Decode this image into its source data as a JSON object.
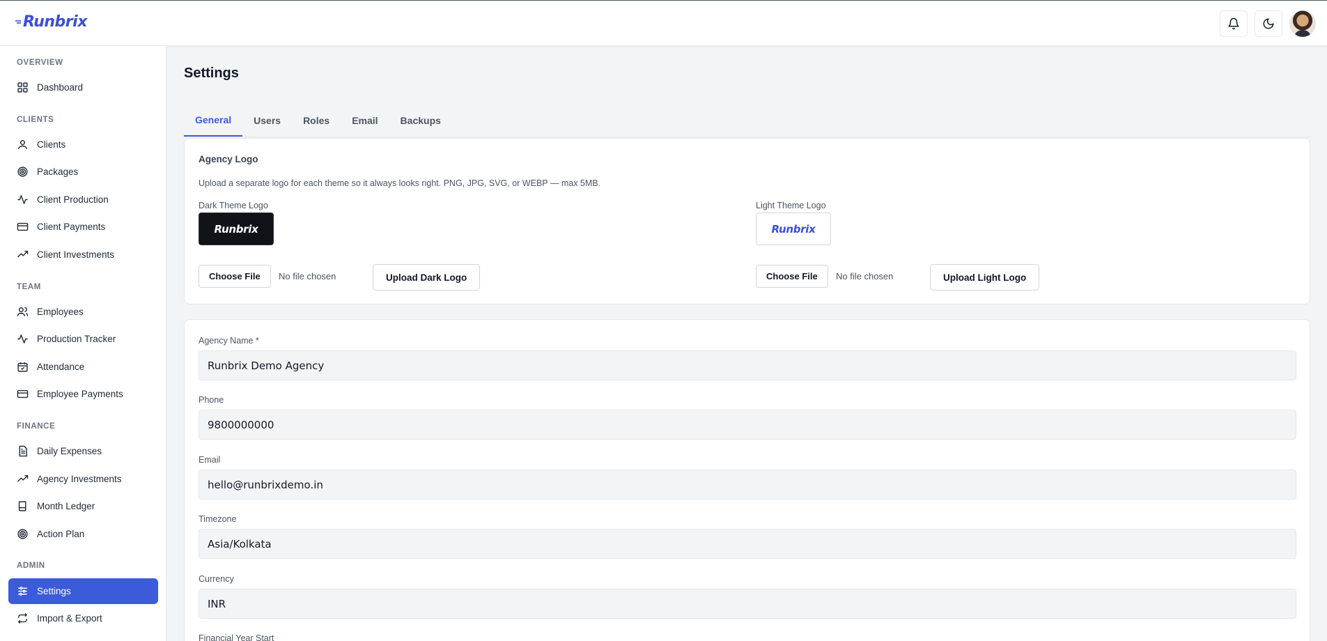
{
  "header": {
    "brand": "Runbrix",
    "icons": [
      "bell-icon",
      "moon-icon",
      "avatar"
    ]
  },
  "sidebar": {
    "sections": [
      {
        "label": "OVERVIEW",
        "items": [
          {
            "label": "Dashboard",
            "icon": "grid-icon"
          }
        ]
      },
      {
        "label": "CLIENTS",
        "items": [
          {
            "label": "Clients",
            "icon": "user-icon"
          },
          {
            "label": "Packages",
            "icon": "target-icon"
          },
          {
            "label": "Client Production",
            "icon": "activity-icon"
          },
          {
            "label": "Client Payments",
            "icon": "credit-card-icon"
          },
          {
            "label": "Client Investments",
            "icon": "trending-up-icon"
          }
        ]
      },
      {
        "label": "TEAM",
        "items": [
          {
            "label": "Employees",
            "icon": "users-icon"
          },
          {
            "label": "Production Tracker",
            "icon": "activity-icon"
          },
          {
            "label": "Attendance",
            "icon": "calendar-check-icon"
          },
          {
            "label": "Employee Payments",
            "icon": "credit-card-icon"
          }
        ]
      },
      {
        "label": "FINANCE",
        "items": [
          {
            "label": "Daily Expenses",
            "icon": "file-text-icon"
          },
          {
            "label": "Agency Investments",
            "icon": "trending-up-icon"
          },
          {
            "label": "Month Ledger",
            "icon": "book-icon"
          },
          {
            "label": "Action Plan",
            "icon": "target-icon"
          }
        ]
      },
      {
        "label": "ADMIN",
        "items": [
          {
            "label": "Settings",
            "icon": "sliders-icon",
            "active": true
          },
          {
            "label": "Import & Export",
            "icon": "repeat-icon"
          }
        ]
      }
    ]
  },
  "page": {
    "title": "Settings",
    "tabs": [
      "General",
      "Users",
      "Roles",
      "Email",
      "Backups"
    ],
    "active_tab": "General"
  },
  "logo_card": {
    "title": "Agency Logo",
    "description": "Upload a separate logo for each theme so it always looks right. PNG, JPG, SVG, or WEBP — max 5MB.",
    "dark": {
      "label": "Dark Theme Logo",
      "preview_text": "Runbrix",
      "choose_label": "Choose File",
      "file_status": "No file chosen",
      "upload_label": "Upload Dark Logo"
    },
    "light": {
      "label": "Light Theme Logo",
      "preview_text": "Runbrix",
      "choose_label": "Choose File",
      "file_status": "No file chosen",
      "upload_label": "Upload Light Logo"
    }
  },
  "form": {
    "agency_name": {
      "label": "Agency Name *",
      "value": "Runbrix Demo Agency"
    },
    "phone": {
      "label": "Phone",
      "value": "9800000000"
    },
    "email": {
      "label": "Email",
      "value": "hello@runbrixdemo.in"
    },
    "timezone": {
      "label": "Timezone",
      "value": "Asia/Kolkata"
    },
    "currency": {
      "label": "Currency",
      "value": "INR"
    },
    "financial_year_start": {
      "label": "Financial Year Start"
    }
  },
  "colors": {
    "accent": "#3b5bdb",
    "brand": "#3b4fd8"
  }
}
